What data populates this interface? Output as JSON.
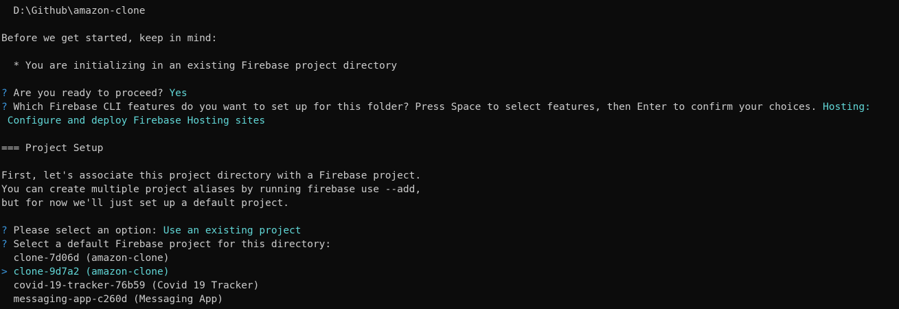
{
  "terminal": {
    "path": "  D:\\Github\\amazon-clone",
    "before_start": "Before we get started, keep in mind:",
    "bullet": "  * You are initializing in an existing Firebase project directory",
    "q1": {
      "prompt_mark": "?",
      "question": " Are you ready to proceed? ",
      "answer": "Yes"
    },
    "q2": {
      "prompt_mark": "?",
      "question": " Which Firebase CLI features do you want to set up for this folder? Press Space to select features, then Enter to confirm your choices. ",
      "answer_part1": "Hosting:",
      "answer_part2": " Configure and deploy Firebase Hosting sites"
    },
    "section_header": "=== Project Setup",
    "info_1": "First, let's associate this project directory with a Firebase project.",
    "info_2": "You can create multiple project aliases by running firebase use --add,",
    "info_3": "but for now we'll just set up a default project.",
    "q3": {
      "prompt_mark": "?",
      "question": " Please select an option: ",
      "answer": "Use an existing project"
    },
    "q4": {
      "prompt_mark": "?",
      "question": " Select a default Firebase project for this directory:"
    },
    "projects": [
      {
        "pointer": " ",
        "label": " clone-7d06d (amazon-clone)"
      },
      {
        "pointer": ">",
        "label": " clone-9d7a2 (amazon-clone)"
      },
      {
        "pointer": " ",
        "label": " covid-19-tracker-76b59 (Covid 19 Tracker)"
      },
      {
        "pointer": " ",
        "label": " messaging-app-c260d (Messaging App)"
      }
    ],
    "colors": {
      "background": "#0c0c0c",
      "foreground": "#cccccc",
      "prompt": "#3a96dd",
      "answer": "#61d6d6"
    }
  }
}
